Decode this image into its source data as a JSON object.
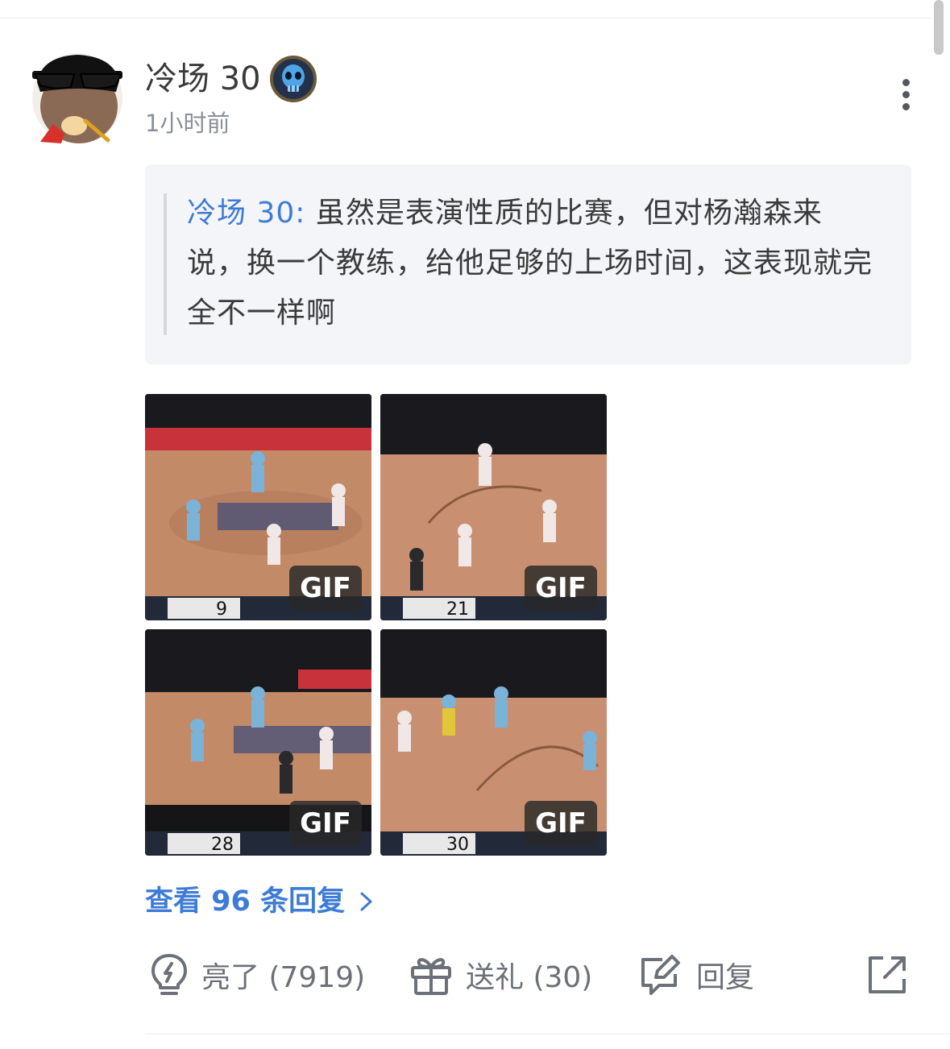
{
  "post": {
    "username": "冷场 30",
    "timestamp": "1小时前",
    "quote_author": "冷场 30:",
    "quote_text": " 虽然是表演性质的比赛，但对杨瀚森来说，换一个教练，给他足够的上场时间，这表现就完全不一样啊",
    "gifs": [
      {
        "label": "GIF",
        "score": "9",
        "scheme": "blue"
      },
      {
        "label": "GIF",
        "score": "21",
        "scheme": "white"
      },
      {
        "label": "GIF",
        "score": "28",
        "scheme": "blue"
      },
      {
        "label": "GIF",
        "score": "30",
        "scheme": "white"
      }
    ],
    "view_replies_label": "查看 96 条回复"
  },
  "actions": {
    "like_label": "亮了 (7919)",
    "gift_label": "送礼 (30)",
    "reply_label": "回复",
    "share_icon": "share-icon"
  },
  "colors": {
    "link": "#3d7bd6",
    "quote_bg": "#f3f5f8",
    "icon_gray": "#6b7079"
  }
}
